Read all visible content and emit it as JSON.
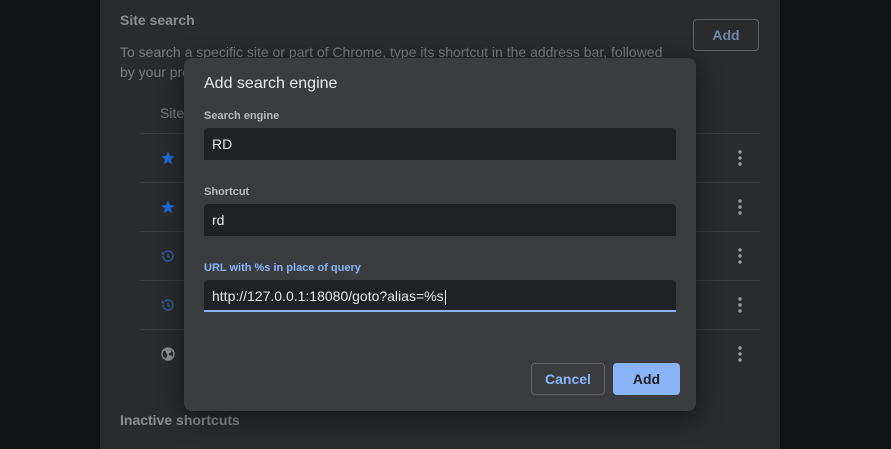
{
  "settings": {
    "section_title": "Site search",
    "description": "To search a specific site or part of Chrome, type its shortcut in the address bar, followed by your preferred k",
    "add_label": "Add",
    "column_header": "Site",
    "inactive_title": "Inactive shortcuts",
    "rows": [
      {
        "icon": "star-icon"
      },
      {
        "icon": "star-icon"
      },
      {
        "icon": "history-icon"
      },
      {
        "icon": "history-icon"
      },
      {
        "icon": "globe-icon"
      }
    ]
  },
  "dialog": {
    "title": "Add search engine",
    "engine_label": "Search engine",
    "engine_value": "RD",
    "shortcut_label": "Shortcut",
    "shortcut_value": "rd",
    "url_label": "URL with %s in place of query",
    "url_value": "http://127.0.0.1:18080/goto?alias=%s",
    "cancel_label": "Cancel",
    "add_label": "Add"
  },
  "colors": {
    "accent": "#8ab4f8",
    "dialog_bg": "#3b3c3f",
    "input_bg": "#202124",
    "page_bg": "#2a2b2d",
    "star": "#1f6ad4"
  }
}
